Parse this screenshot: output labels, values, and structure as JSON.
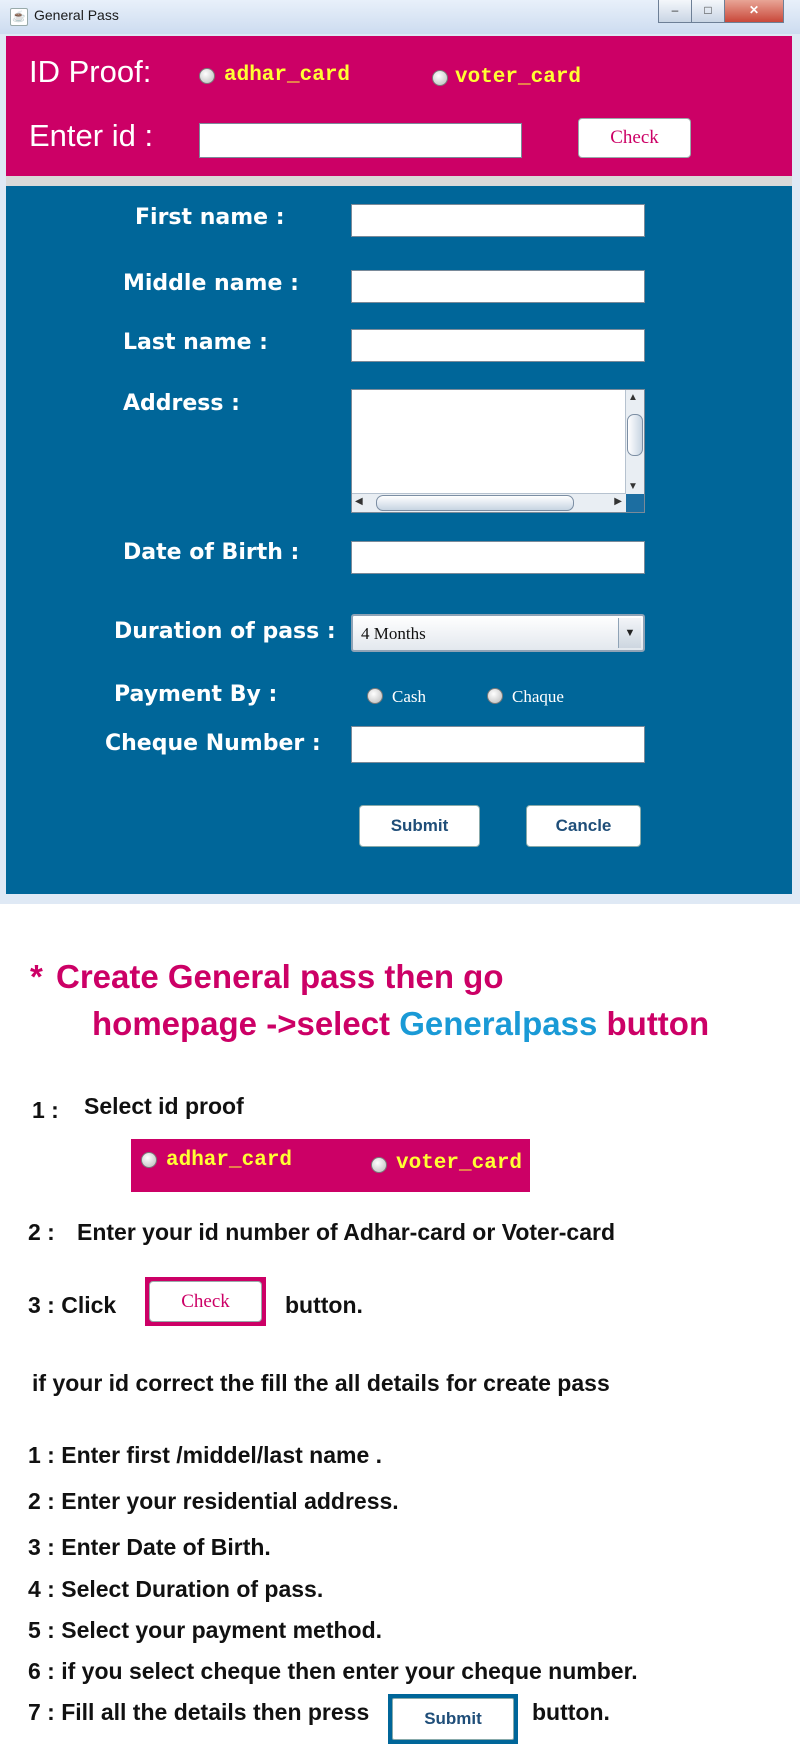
{
  "window": {
    "title": "General Pass",
    "app_icon": "java-icon",
    "controls": [
      "minimize",
      "maximize",
      "close"
    ]
  },
  "id_proof": {
    "label": "ID Proof:",
    "options": [
      "adhar_card",
      "voter_card"
    ],
    "enter_id_label": "Enter id :",
    "id_value": "",
    "check_label": "Check"
  },
  "form": {
    "first_name_label": "First name :",
    "middle_name_label": "Middle name :",
    "last_name_label": "Last name :",
    "address_label": "Address :",
    "dob_label": "Date of Birth :",
    "duration_label": "Duration of pass :",
    "duration_value": "4 Months",
    "payment_label": "Payment By :",
    "payment_options": [
      "Cash",
      "Chaque"
    ],
    "cheque_label": "Cheque Number :",
    "submit_label": "Submit",
    "cancel_label": "Cancle"
  },
  "instructions": {
    "heading_star": "*",
    "heading_line1": "Create General pass then go",
    "heading_line2_a": "homepage ->select",
    "heading_line2_b": "Generalpass",
    "heading_line2_c": "button",
    "step1_num": "1 :",
    "step1_text": "Select id proof",
    "step1_opt1": "adhar_card",
    "step1_opt2": "voter_card",
    "step2_num": "2 :",
    "step2_text": "Enter your id number of Adhar-card or Voter-card",
    "step3_text": "3 : Click",
    "step3_button": "Check",
    "step3_after": "button.",
    "note": "if your id correct the fill the all details for create pass",
    "list": [
      "1 : Enter first /middel/last name .",
      "2 :  Enter your residential address.",
      "3 : Enter Date of Birth.",
      "4 : Select Duration of pass.",
      "5 : Select your payment method.",
      "6 : if you select cheque then enter your cheque number.",
      "7 : Fill all the details then press"
    ],
    "step7_button": "Submit",
    "step7_after": "button."
  },
  "colors": {
    "pink": "#cc0066",
    "blue_panel": "#006699",
    "accent_blue": "#1a9ad6"
  }
}
